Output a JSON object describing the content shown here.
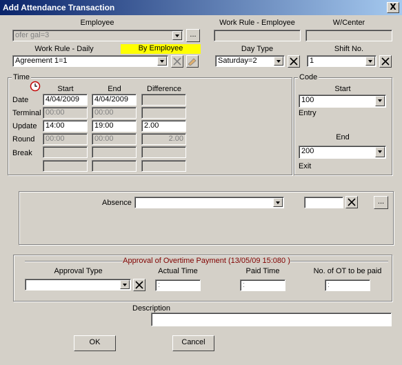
{
  "window": {
    "title": "Add Attendance Transaction",
    "close": "X"
  },
  "employee": {
    "label": "Employee",
    "value": "ofer gal=3",
    "browse": "..."
  },
  "work_rule_employee": {
    "label": "Work Rule - Employee",
    "value": ""
  },
  "work_center": {
    "label": "W/Center",
    "value": ""
  },
  "work_rule_daily": {
    "label": "Work Rule - Daily",
    "by_employee": "By Employee",
    "value": "Agreement 1=1"
  },
  "day_type": {
    "label": "Day Type",
    "value": "Saturday=2"
  },
  "shift_no": {
    "label": "Shift No.",
    "value": "1"
  },
  "time": {
    "title": "Time",
    "col_start": "Start",
    "col_end": "End",
    "col_diff": "Difference",
    "rows": {
      "date": {
        "label": "Date",
        "start": "4/04/2009",
        "end": "4/04/2009",
        "diff": ""
      },
      "terminal": {
        "label": "Terminal",
        "start": "00:00",
        "end": "00:00",
        "diff": ""
      },
      "update": {
        "label": "Update",
        "start": "14:00",
        "end": "19:00",
        "diff": "2.00"
      },
      "round": {
        "label": "Round",
        "start": "00:00",
        "end": "00:00",
        "diff": "2.00"
      },
      "break": {
        "label": "Break"
      }
    }
  },
  "code": {
    "title": "Code",
    "start_label": "Start",
    "start_value": "100",
    "entry": "Entry",
    "end_label": "End",
    "end_value": "200",
    "exit": "Exit"
  },
  "absence": {
    "label": "Absence",
    "value": "",
    "extra": "",
    "browse": "..."
  },
  "overtime": {
    "title": "Approval of Overtime Payment (13/05/09 15:080 )",
    "approval_type_label": "Approval Type",
    "approval_type_value": "",
    "actual_time_label": "Actual Time",
    "actual_time_value": ":",
    "paid_time_label": "Paid Time",
    "paid_time_value": ":",
    "no_ot_label": "No. of OT to be paid",
    "no_ot_value": ":"
  },
  "description": {
    "label": "Description",
    "value": ""
  },
  "buttons": {
    "ok": "OK",
    "cancel": "Cancel"
  },
  "colors": {
    "title_start": "#0a246a",
    "title_end": "#a6caf0",
    "face": "#d4d0c8",
    "highlight": "#ffff00",
    "overtime_title": "#800000"
  }
}
